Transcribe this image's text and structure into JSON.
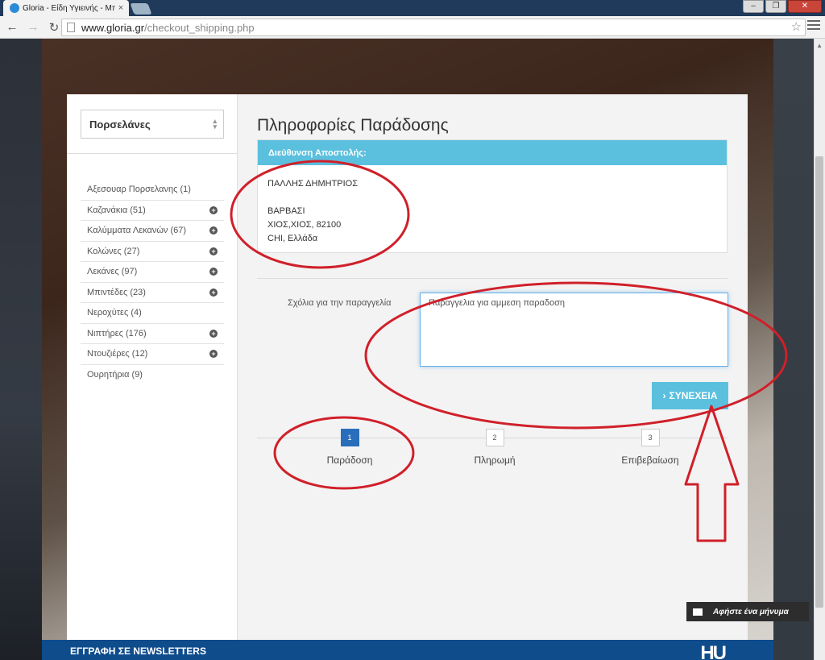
{
  "browser": {
    "tab_title": "Gloria - Είδη Υγιεινής - Μπ",
    "url_domain": "www.gloria.gr",
    "url_path": "/checkout_shipping.php"
  },
  "sidebar": {
    "select_value": "Πορσελάνες",
    "categories": [
      {
        "label": "Αξεσουαρ Πορσελανης (1)",
        "expandable": false
      },
      {
        "label": "Καζανάκια (51)",
        "expandable": true
      },
      {
        "label": "Καλύμματα Λεκανών (67)",
        "expandable": true
      },
      {
        "label": "Κολώνες (27)",
        "expandable": true
      },
      {
        "label": "Λεκάνες (97)",
        "expandable": true
      },
      {
        "label": "Μπιντέδες (23)",
        "expandable": true
      },
      {
        "label": "Νεροχύτες (4)",
        "expandable": false
      },
      {
        "label": "Νιπτήρες (176)",
        "expandable": true
      },
      {
        "label": "Ντουζιέρες (12)",
        "expandable": true
      },
      {
        "label": "Ουρητήρια (9)",
        "expandable": false
      }
    ]
  },
  "main": {
    "title": "Πληροφορίες Παράδοσης",
    "address_panel": {
      "heading": "Διεύθυνση Αποστολής:",
      "name": "ΠΑΛΛΗΣ ΔΗΜΗΤΡΙΟΣ",
      "line1": "ΒΑΡΒΑΣΙ",
      "line2": "ΧΙΟΣ,ΧΙΟΣ, 82100",
      "line3": "CHI, Ελλάδα"
    },
    "comments_label": "Σχόλια για την παραγγελία",
    "comments_value": "Παραγγελια για αμμεση παραδοση",
    "continue_label": "ΣΥΝΕΧΕΙΑ",
    "steps": [
      {
        "num": "1",
        "label": "Παράδοση"
      },
      {
        "num": "2",
        "label": "Πληρωμή"
      },
      {
        "num": "3",
        "label": "Επιβεβαίωση"
      }
    ]
  },
  "footer": {
    "newsletter": "ΕΓΓΡΑΦΗ ΣΕ NEWSLETTERS",
    "chat": "Αφήστε ένα μήνυμα"
  },
  "colors": {
    "accent": "#5bc0de",
    "step_active": "#2a6ebb",
    "annotation": "#d0202a",
    "footer": "#0f4c8c"
  }
}
